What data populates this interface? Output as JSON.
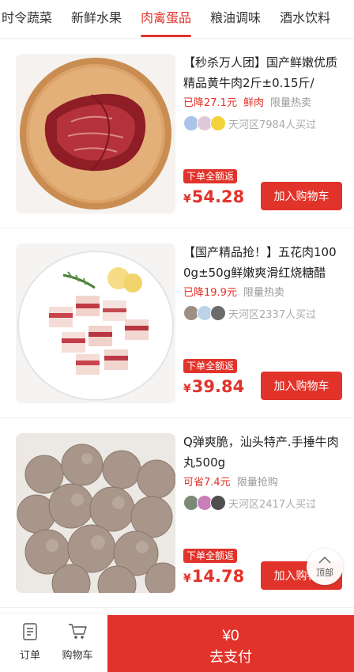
{
  "tabs": [
    "时令蔬菜",
    "新鲜水果",
    "肉禽蛋品",
    "粮油调味",
    "酒水饮料"
  ],
  "active_tab": "肉禽蛋品",
  "products": [
    {
      "title": "【秒杀万人团】国产鲜嫩优质 精品黄牛肉2斤±0.15斤/",
      "tag_red": "已降27.1元",
      "tag_red2": "鲜肉",
      "tag_gray": "限量热卖",
      "buyers": "天河区7984人买过",
      "badge": "下单全额返",
      "currency": "¥",
      "price": "54.28",
      "cart_label": "加入购物车",
      "image_icon": "beef-image"
    },
    {
      "title": "【国产精品抢！】五花肉1000g±50g鲜嫩爽滑红烧糖醋",
      "tag_red": "已降19.9元",
      "tag_red2": "",
      "tag_gray": "限量热卖",
      "buyers": "天河区2337人买过",
      "badge": "下单全额返",
      "currency": "¥",
      "price": "39.84",
      "cart_label": "加入购物车",
      "image_icon": "pork-belly-image"
    },
    {
      "title": "Q弹爽脆，汕头特产.手捶牛肉丸500g",
      "tag_red": "可省7.4元",
      "tag_red2": "",
      "tag_gray": "限量抢购",
      "buyers": "天河区2417人买过",
      "badge": "下单全额返",
      "currency": "¥",
      "price": "14.78",
      "cart_label": "加入购物车",
      "image_icon": "meatball-image"
    }
  ],
  "to_top_label": "顶部",
  "bottom": {
    "orders_label": "订单",
    "cart_label": "购物车",
    "pay_amount": "¥0",
    "pay_label": "去支付"
  },
  "colors": {
    "accent": "#e2332b",
    "muted": "#999999"
  }
}
